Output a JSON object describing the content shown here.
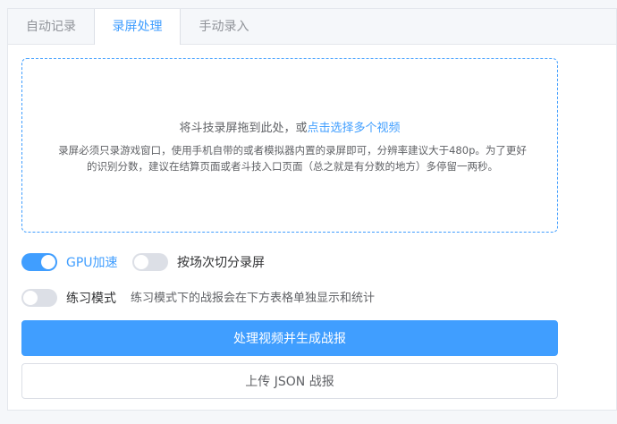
{
  "tabs": [
    {
      "label": "自动记录",
      "active": false
    },
    {
      "label": "录屏处理",
      "active": true
    },
    {
      "label": "手动录入",
      "active": false
    }
  ],
  "upload": {
    "prompt_prefix": "将斗技录屏拖到此处，或",
    "prompt_link": "点击选择多个视频",
    "description": "录屏必须只录游戏窗口，使用手机自带的或者模拟器内置的录屏即可，分辨率建议大于480p。为了更好的识别分数，建议在结算页面或者斗技入口页面（总之就是有分数的地方）多停留一两秒。"
  },
  "options": {
    "gpu": {
      "label": "GPU加速",
      "enabled": true
    },
    "split": {
      "label": "按场次切分录屏",
      "enabled": false
    },
    "practice": {
      "label": "练习模式",
      "enabled": false,
      "hint": "练习模式下的战报会在下方表格单独显示和统计"
    }
  },
  "actions": {
    "process_label": "处理视频并生成战报",
    "upload_json_label": "上传 JSON 战报"
  },
  "colors": {
    "accent": "#409eff",
    "switch_off": "#dcdfe6"
  }
}
